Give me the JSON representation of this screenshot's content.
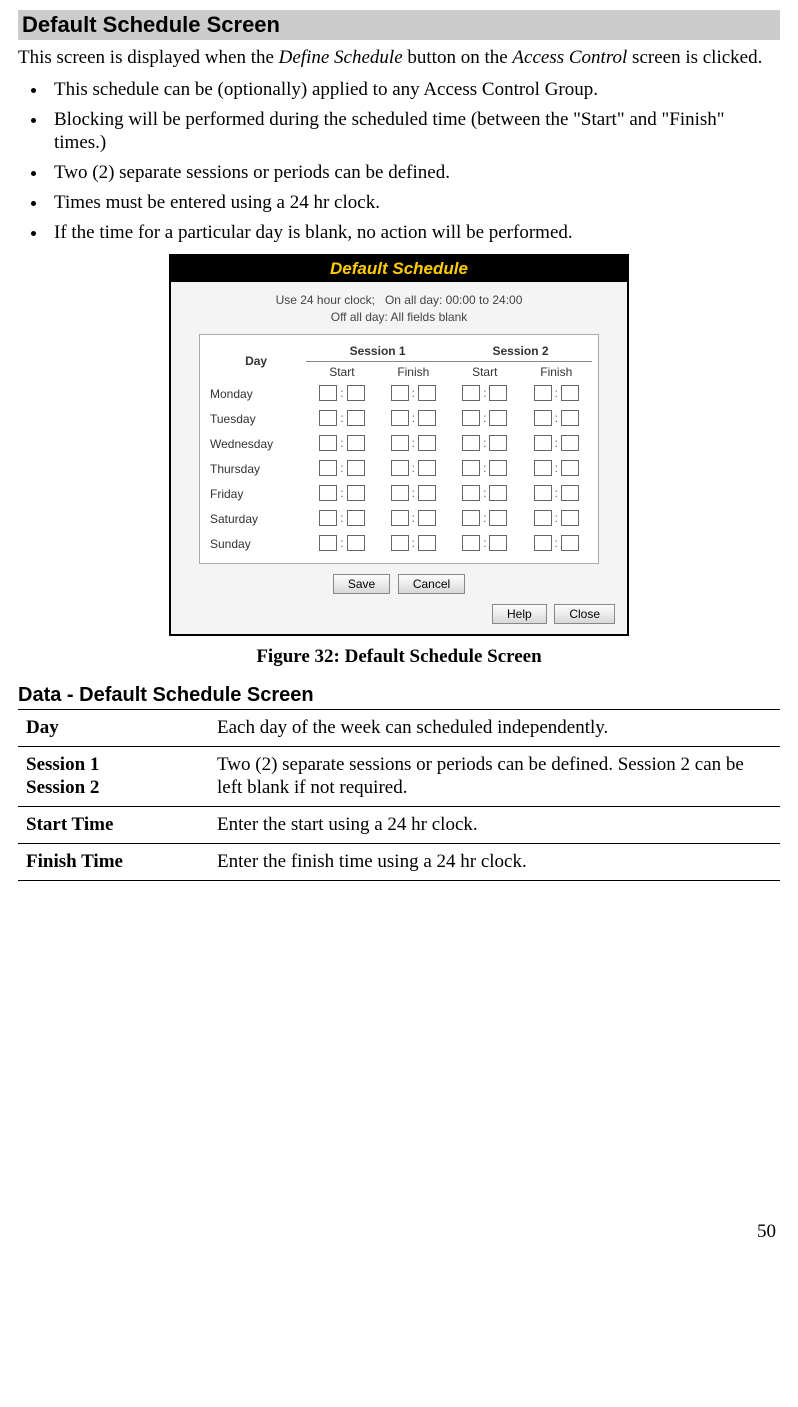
{
  "section_title": "Default Schedule Screen",
  "intro": {
    "pre": "This screen is displayed when the ",
    "em1": "Define Schedule",
    "mid": " button on the ",
    "em2": "Access Control",
    "post": " screen is clicked."
  },
  "bullets": [
    "This schedule can be (optionally) applied to any Access Control Group.",
    "Blocking will be performed during the scheduled time (between the \"Start\" and \"Finish\" times.)",
    "Two (2) separate sessions or periods can be defined.",
    "Times must be entered using a 24 hr clock.",
    "If the time for a particular day is blank, no action will be performed."
  ],
  "figure": {
    "title": "Default Schedule",
    "instr1": "Use 24 hour clock;   On all day: 00:00 to 24:00",
    "instr2": "Off all day: All fields blank",
    "headers": {
      "day": "Day",
      "session1": "Session 1",
      "session2": "Session 2",
      "start": "Start",
      "finish": "Finish"
    },
    "days": [
      "Monday",
      "Tuesday",
      "Wednesday",
      "Thursday",
      "Friday",
      "Saturday",
      "Sunday"
    ],
    "buttons": {
      "save": "Save",
      "cancel": "Cancel",
      "help": "Help",
      "close": "Close"
    }
  },
  "figure_caption": "Figure 32: Default Schedule Screen",
  "subsection_title": "Data - Default Schedule Screen",
  "data_rows": [
    {
      "k": "Day",
      "v": "Each day of the week can scheduled independently."
    },
    {
      "k": "Session 1\nSession 2",
      "v": "Two (2) separate sessions or periods can be defined. Session 2 can be left blank if not required."
    },
    {
      "k": "Start Time",
      "v": "Enter the start using a 24 hr clock."
    },
    {
      "k": "Finish Time",
      "v": "Enter the finish time using a 24 hr clock."
    }
  ],
  "page_number": "50"
}
